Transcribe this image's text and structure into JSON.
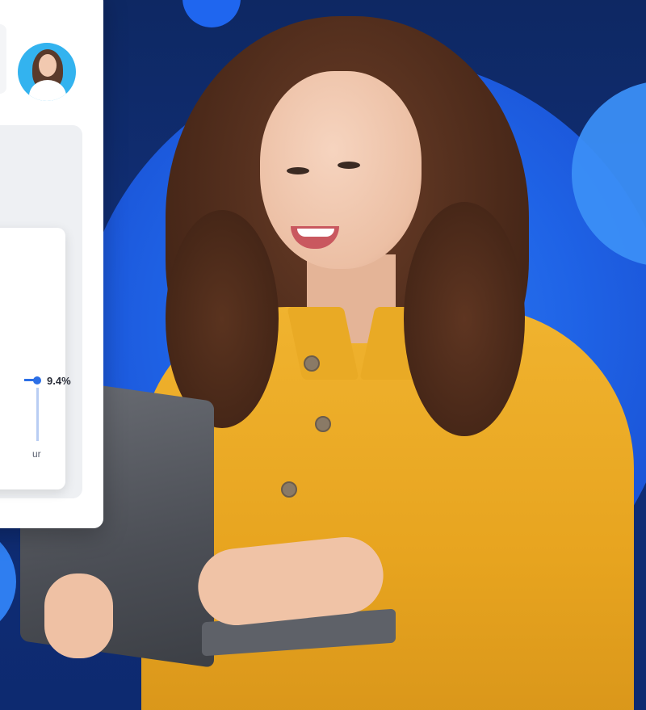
{
  "dashboard": {
    "chart_data": {
      "type": "line",
      "data_label": "9.4%",
      "x_axis_label_fragment": "ur"
    }
  },
  "colors": {
    "background_dark": "#0e2863",
    "accent_blue": "#1f63e6",
    "light_blue": "#3b8ef5",
    "shirt_yellow": "#e7a41f"
  },
  "icons": {
    "avatar": "profile-avatar"
  }
}
